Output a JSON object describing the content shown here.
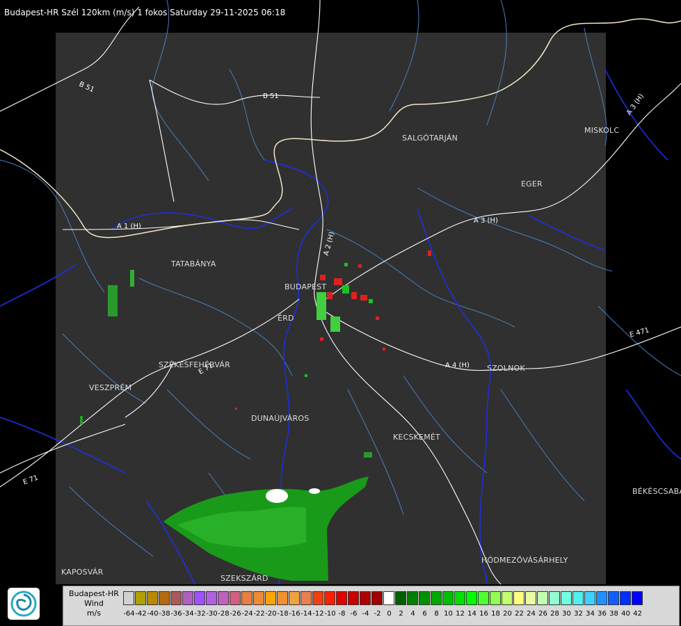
{
  "header": {
    "title": "Budapest-HR Szél 120km (m/s) 1 fokos Saturday 29-11-2025 06:18"
  },
  "cities": [
    {
      "name": "SALGÓTARJÁN"
    },
    {
      "name": "MISKOLC"
    },
    {
      "name": "EGER"
    },
    {
      "name": "TATABÁNYA"
    },
    {
      "name": "BUDAPEST"
    },
    {
      "name": "ÉRD"
    },
    {
      "name": "SZÉKESFEHÉRVÁR"
    },
    {
      "name": "VESZPRÉM"
    },
    {
      "name": "DUNAÚJVÁROS"
    },
    {
      "name": "KECSKEMÉT"
    },
    {
      "name": "SZOLNOK"
    },
    {
      "name": "BÉKÉSCSABA"
    },
    {
      "name": "HÓDMEZŐVÁSÁRHELY"
    },
    {
      "name": "KAPOSVÁR"
    },
    {
      "name": "SZEKSZÁRD"
    }
  ],
  "roads": [
    {
      "name": "B 51"
    },
    {
      "name": "B 51"
    },
    {
      "name": "A 1 (H)"
    },
    {
      "name": "A 2 (H)"
    },
    {
      "name": "A 3 (H)"
    },
    {
      "name": "A 3 (H)"
    },
    {
      "name": "A 4 (H)"
    },
    {
      "name": "E 471"
    },
    {
      "name": "E 71"
    },
    {
      "name": "E 71"
    }
  ],
  "legend": {
    "title_line1": "Budapest-HR",
    "title_line2": "Wind",
    "title_line3": "m/s",
    "ticks": [
      "-64",
      "-42",
      "-40",
      "-38",
      "-36",
      "-34",
      "-32",
      "-30",
      "-28",
      "-26",
      "-24",
      "-22",
      "-20",
      "-18",
      "-16",
      "-14",
      "-12",
      "-10",
      "-8",
      "-6",
      "-4",
      "-2",
      "0",
      "2",
      "4",
      "6",
      "8",
      "10",
      "12",
      "14",
      "16",
      "18",
      "20",
      "22",
      "24",
      "26",
      "28",
      "30",
      "32",
      "34",
      "36",
      "38",
      "40",
      "42"
    ],
    "colors": [
      "#d0d0d0",
      "#b0a000",
      "#b88a00",
      "#b36a10",
      "#a95a5a",
      "#b060c0",
      "#a050ff",
      "#b060e0",
      "#c060c0",
      "#d06080",
      "#e87f40",
      "#f08a30",
      "#ffa500",
      "#f09030",
      "#f0a040",
      "#e88050",
      "#f04010",
      "#ff2000",
      "#e00000",
      "#c80000",
      "#b00000",
      "#a00000",
      "#ffffff",
      "#006000",
      "#008000",
      "#009000",
      "#00a800",
      "#00c000",
      "#00e000",
      "#00ff00",
      "#50ff30",
      "#90ff50",
      "#c0ff70",
      "#ffff80",
      "#e8ffa0",
      "#c0ffb0",
      "#90ffd0",
      "#70ffe0",
      "#50f0f0",
      "#40d0ff",
      "#2090ff",
      "#1060ff",
      "#0030ff",
      "#0000ff"
    ],
    "accent": "#00a000"
  }
}
